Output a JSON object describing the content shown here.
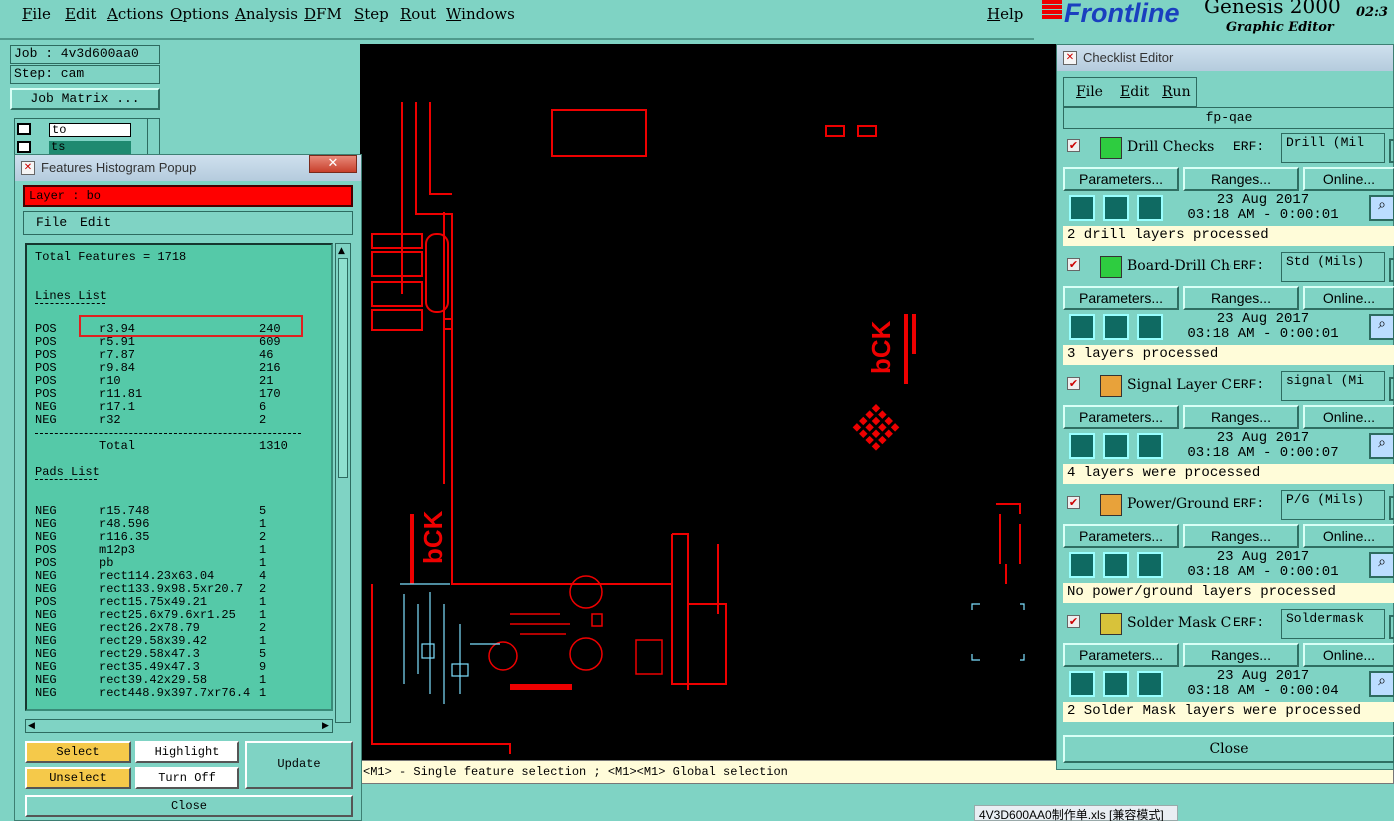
{
  "menubar": {
    "items": [
      "File",
      "Edit",
      "Actions",
      "Options",
      "Analysis",
      "DFM",
      "Step",
      "Rout",
      "Windows"
    ],
    "help": "Help"
  },
  "brand": {
    "logo_text": "Frontline",
    "product": "Genesis 2000",
    "subtitle": "Graphic Editor",
    "clock": "02:3"
  },
  "job": {
    "job_label": "Job : 4v3d600aa0",
    "step_label": "Step: cam",
    "matrix_button": "Job Matrix ...",
    "layers": [
      "to",
      "ts"
    ]
  },
  "histogram": {
    "title": "Features Histogram Popup",
    "layer": "Layer :  bo",
    "menu": [
      "File",
      "Edit"
    ],
    "total": "Total Features = 1718",
    "lines_header": "Lines List",
    "lines": [
      {
        "kind": "POS",
        "sym": "r3.94",
        "count": "240"
      },
      {
        "kind": "POS",
        "sym": "r5.91",
        "count": "609"
      },
      {
        "kind": "POS",
        "sym": "r7.87",
        "count": "46"
      },
      {
        "kind": "POS",
        "sym": "r9.84",
        "count": "216"
      },
      {
        "kind": "POS",
        "sym": "r10",
        "count": "21"
      },
      {
        "kind": "POS",
        "sym": "r11.81",
        "count": "170"
      },
      {
        "kind": "NEG",
        "sym": "r17.1",
        "count": "6"
      },
      {
        "kind": "NEG",
        "sym": "r32",
        "count": "2"
      }
    ],
    "lines_total_label": "Total",
    "lines_total": "1310",
    "pads_header": "Pads List",
    "pads": [
      {
        "kind": "NEG",
        "sym": "r15.748",
        "count": "5"
      },
      {
        "kind": "NEG",
        "sym": "r48.596",
        "count": "1"
      },
      {
        "kind": "NEG",
        "sym": "r116.35",
        "count": "2"
      },
      {
        "kind": "POS",
        "sym": "m12p3",
        "count": "1"
      },
      {
        "kind": "POS",
        "sym": "pb",
        "count": "1"
      },
      {
        "kind": "NEG",
        "sym": "rect114.23x63.04",
        "count": "4"
      },
      {
        "kind": "NEG",
        "sym": "rect133.9x98.5xr20.7",
        "count": "2"
      },
      {
        "kind": "POS",
        "sym": "rect15.75x49.21",
        "count": "1"
      },
      {
        "kind": "NEG",
        "sym": "rect25.6x79.6xr1.25",
        "count": "1"
      },
      {
        "kind": "NEG",
        "sym": "rect26.2x78.79",
        "count": "2"
      },
      {
        "kind": "NEG",
        "sym": "rect29.58x39.42",
        "count": "1"
      },
      {
        "kind": "NEG",
        "sym": "rect29.58x47.3",
        "count": "5"
      },
      {
        "kind": "NEG",
        "sym": "rect35.49x47.3",
        "count": "9"
      },
      {
        "kind": "NEG",
        "sym": "rect39.42x29.58",
        "count": "1"
      },
      {
        "kind": "NEG",
        "sym": "rect448.9x397.7xr76.4",
        "count": "1"
      }
    ],
    "buttons": {
      "select": "Select",
      "unselect": "Unselect",
      "highlight": "Highlight",
      "turn_off": "Turn Off",
      "update": "Update",
      "close": "Close"
    }
  },
  "canvas": {
    "board_text": "bCK"
  },
  "status": {
    "hint": "<M1> - Single feature selection ; <M1><M1> Global selection"
  },
  "taskbar": {
    "item": "4V3D600AA0制作单.xls  [兼容模式]"
  },
  "checklist": {
    "title": "Checklist Editor",
    "menu": [
      "File",
      "Edit",
      "Run"
    ],
    "name": "fp-qae",
    "param_label": "Parameters...",
    "ranges_label": "Ranges...",
    "online_label": "Online...",
    "erf_label": "ERF:",
    "close": "Close",
    "actions": [
      {
        "name": "Drill Checks",
        "erf": "Drill (Mil",
        "date": "23 Aug 2017",
        "time": "03:18 AM - 0:00:01",
        "result": "2 drill layers processed",
        "icon_color": "#2ecc40"
      },
      {
        "name": "Board-Drill Checks",
        "erf": "Std (Mils)",
        "date": "23 Aug 2017",
        "time": "03:18 AM - 0:00:01",
        "result": "3 layers processed",
        "icon_color": "#2ecc40"
      },
      {
        "name": "Signal Layer Checks",
        "erf": "signal (Mi",
        "date": "23 Aug 2017",
        "time": "03:18 AM - 0:00:07",
        "result": "4 layers were processed",
        "icon_color": "#e8a23a"
      },
      {
        "name": "Power/Ground Checks",
        "erf": "P/G (Mils)",
        "date": "23 Aug 2017",
        "time": "03:18 AM - 0:00:01",
        "result": "No power/ground layers processed",
        "icon_color": "#e8a23a"
      },
      {
        "name": "Solder Mask Checks",
        "erf": "Soldermask",
        "date": "23 Aug 2017",
        "time": "03:18 AM - 0:00:04",
        "result": "2 Solder Mask layers were processed",
        "icon_color": "#d8c23a"
      }
    ]
  }
}
